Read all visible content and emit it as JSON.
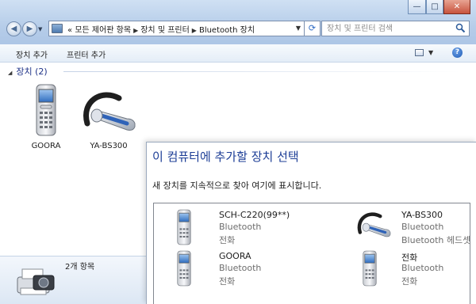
{
  "window": {
    "controls": {
      "minimize": "—",
      "maximize": "□",
      "close": "✕"
    }
  },
  "nav": {
    "back_icon": "arrow-left-icon",
    "forward_icon": "arrow-right-icon"
  },
  "address": {
    "overflow": "«",
    "crumbs": [
      "모든 제어판 항목",
      "장치 및 프린터",
      "Bluetooth 장치"
    ]
  },
  "search": {
    "placeholder": "장치 및 프린터 검색"
  },
  "toolbar": {
    "add_device": "장치 추가",
    "add_printer": "프린터 추가",
    "help": "?"
  },
  "group": {
    "title": "장치 (2)"
  },
  "devices": [
    {
      "label": "GOORA",
      "icon": "phone-icon"
    },
    {
      "label": "YA-BS300",
      "icon": "headset-icon"
    }
  ],
  "status": {
    "count": "2개 항목",
    "icon": "printer-camera-icon"
  },
  "wizard": {
    "title": "이 컴퓨터에 추가할 장치 선택",
    "description": "새 장치를 지속적으로 찾아 여기에 표시합니다.",
    "devices": [
      {
        "name": "SCH-C220(99**)",
        "type": "Bluetooth",
        "category": "전화",
        "icon": "phone-icon"
      },
      {
        "name": "YA-BS300",
        "type": "Bluetooth",
        "category": "Bluetooth 헤드셋",
        "icon": "headset-icon"
      },
      {
        "name": "GOORA",
        "type": "Bluetooth",
        "category": "전화",
        "icon": "phone-icon"
      },
      {
        "name": "전화",
        "type": "Bluetooth",
        "category": "전화",
        "icon": "phone-icon"
      }
    ]
  }
}
